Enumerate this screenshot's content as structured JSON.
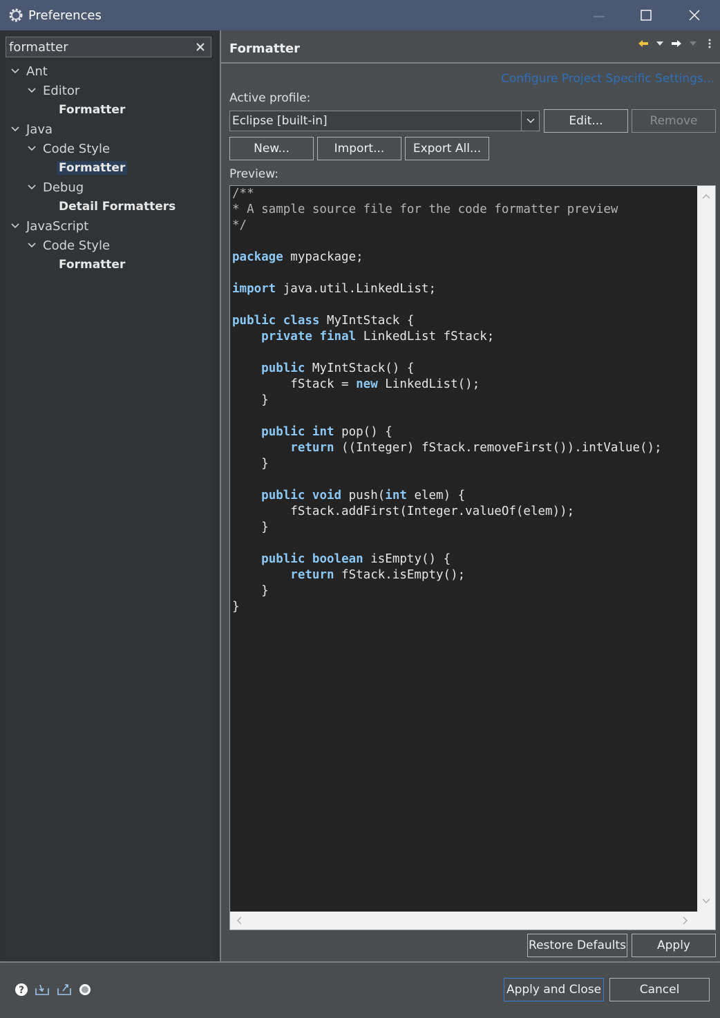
{
  "window": {
    "title": "Preferences"
  },
  "search": {
    "value": "formatter"
  },
  "tree": [
    {
      "label": "Ant"
    },
    {
      "label": "Editor"
    },
    {
      "label": "Formatter"
    },
    {
      "label": "Java"
    },
    {
      "label": "Code Style"
    },
    {
      "label": "Formatter"
    },
    {
      "label": "Debug"
    },
    {
      "label": "Detail Formatters"
    },
    {
      "label": "JavaScript"
    },
    {
      "label": "Code Style"
    },
    {
      "label": "Formatter"
    }
  ],
  "page": {
    "title": "Formatter",
    "config_link": "Configure Project Specific Settings...",
    "active_profile_label": "Active profile:",
    "profile_value": "Eclipse [built-in]",
    "edit_label": "Edit...",
    "remove_label": "Remove",
    "new_label": "New...",
    "import_label": "Import...",
    "export_label": "Export All...",
    "preview_label": "Preview:",
    "restore_label": "Restore Defaults",
    "apply_label": "Apply"
  },
  "code_lines": [
    [
      [
        "cm",
        "/**"
      ]
    ],
    [
      [
        "cm",
        "* A sample source file for the code formatter preview"
      ]
    ],
    [
      [
        "cm",
        "*/"
      ]
    ],
    [],
    [
      [
        "kw",
        "package"
      ],
      [
        "t",
        " mypackage;"
      ]
    ],
    [],
    [
      [
        "kw",
        "import"
      ],
      [
        "t",
        " java.util.LinkedList;"
      ]
    ],
    [],
    [
      [
        "kw",
        "public"
      ],
      [
        "t",
        " "
      ],
      [
        "kw",
        "class"
      ],
      [
        "t",
        " MyIntStack {"
      ]
    ],
    [
      [
        "t",
        "    "
      ],
      [
        "kw",
        "private"
      ],
      [
        "t",
        " "
      ],
      [
        "kw",
        "final"
      ],
      [
        "t",
        " LinkedList fStack;"
      ]
    ],
    [],
    [
      [
        "t",
        "    "
      ],
      [
        "kw",
        "public"
      ],
      [
        "t",
        " MyIntStack() {"
      ]
    ],
    [
      [
        "t",
        "        fStack = "
      ],
      [
        "kw",
        "new"
      ],
      [
        "t",
        " LinkedList();"
      ]
    ],
    [
      [
        "t",
        "    }"
      ]
    ],
    [],
    [
      [
        "t",
        "    "
      ],
      [
        "kw",
        "public"
      ],
      [
        "t",
        " "
      ],
      [
        "kw",
        "int"
      ],
      [
        "t",
        " pop() {"
      ]
    ],
    [
      [
        "t",
        "        "
      ],
      [
        "kw",
        "return"
      ],
      [
        "t",
        " ((Integer) fStack.removeFirst()).intValue();"
      ]
    ],
    [
      [
        "t",
        "    }"
      ]
    ],
    [],
    [
      [
        "t",
        "    "
      ],
      [
        "kw",
        "public"
      ],
      [
        "t",
        " "
      ],
      [
        "kw",
        "void"
      ],
      [
        "t",
        " push("
      ],
      [
        "kw",
        "int"
      ],
      [
        "t",
        " elem) {"
      ]
    ],
    [
      [
        "t",
        "        fStack.addFirst(Integer.valueOf(elem));"
      ]
    ],
    [
      [
        "t",
        "    }"
      ]
    ],
    [],
    [
      [
        "t",
        "    "
      ],
      [
        "kw",
        "public"
      ],
      [
        "t",
        " "
      ],
      [
        "kw",
        "boolean"
      ],
      [
        "t",
        " isEmpty() {"
      ]
    ],
    [
      [
        "t",
        "        "
      ],
      [
        "kw",
        "return"
      ],
      [
        "t",
        " fStack.isEmpty();"
      ]
    ],
    [
      [
        "t",
        "    }"
      ]
    ],
    [
      [
        "t",
        "}"
      ]
    ]
  ],
  "footer": {
    "apply_close_label": "Apply and Close",
    "cancel_label": "Cancel"
  },
  "icons": {
    "app": "gear-icon",
    "clear": "clear-icon",
    "back": "back-arrow-icon",
    "forward": "forward-arrow-icon",
    "menu": "view-menu-icon",
    "help": "help-icon",
    "import": "import-icon",
    "export": "export-icon",
    "oomph": "record-icon"
  },
  "colors": {
    "titlebar": "#4b5872",
    "keyword": "#8bc8f5",
    "link": "#2f6fb8",
    "selection": "#2c3f58"
  }
}
